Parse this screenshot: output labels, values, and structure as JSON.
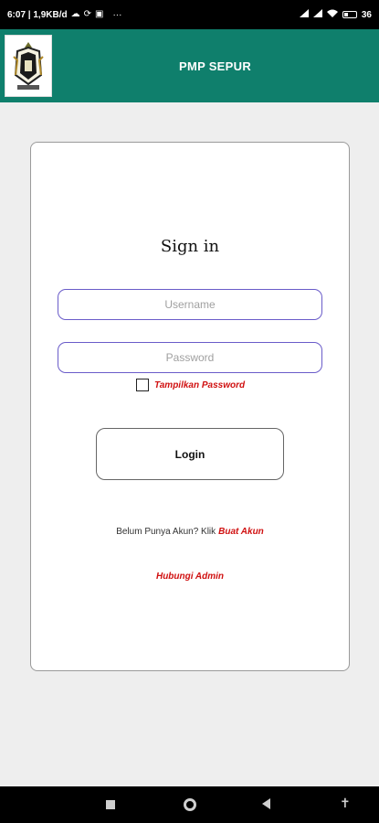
{
  "status_bar": {
    "time_info": "6:07 | 1,9KB/d",
    "overflow": "···",
    "battery": "36",
    "battery_level": 0.36
  },
  "app_bar": {
    "title": "PMP SEPUR",
    "logo_icon": "app-logo-crest",
    "color": "#0f7f6c"
  },
  "signin": {
    "title": "Sign in",
    "username_placeholder": "Username",
    "password_placeholder": "Password",
    "show_password_label": "Tampilkan Password",
    "show_password_checked": false,
    "login_label": "Login",
    "register_prompt": "Belum Punya Akun? Klik",
    "register_link": "Buat Akun",
    "contact_link": "Hubungi Admin",
    "accent_color": "#d01010",
    "field_border_color": "#6a5cc9"
  },
  "nav_bar": {
    "recents_icon": "square-icon",
    "home_icon": "circle-icon",
    "back_icon": "back-triangle-icon",
    "accessibility_icon": "accessibility-icon"
  }
}
